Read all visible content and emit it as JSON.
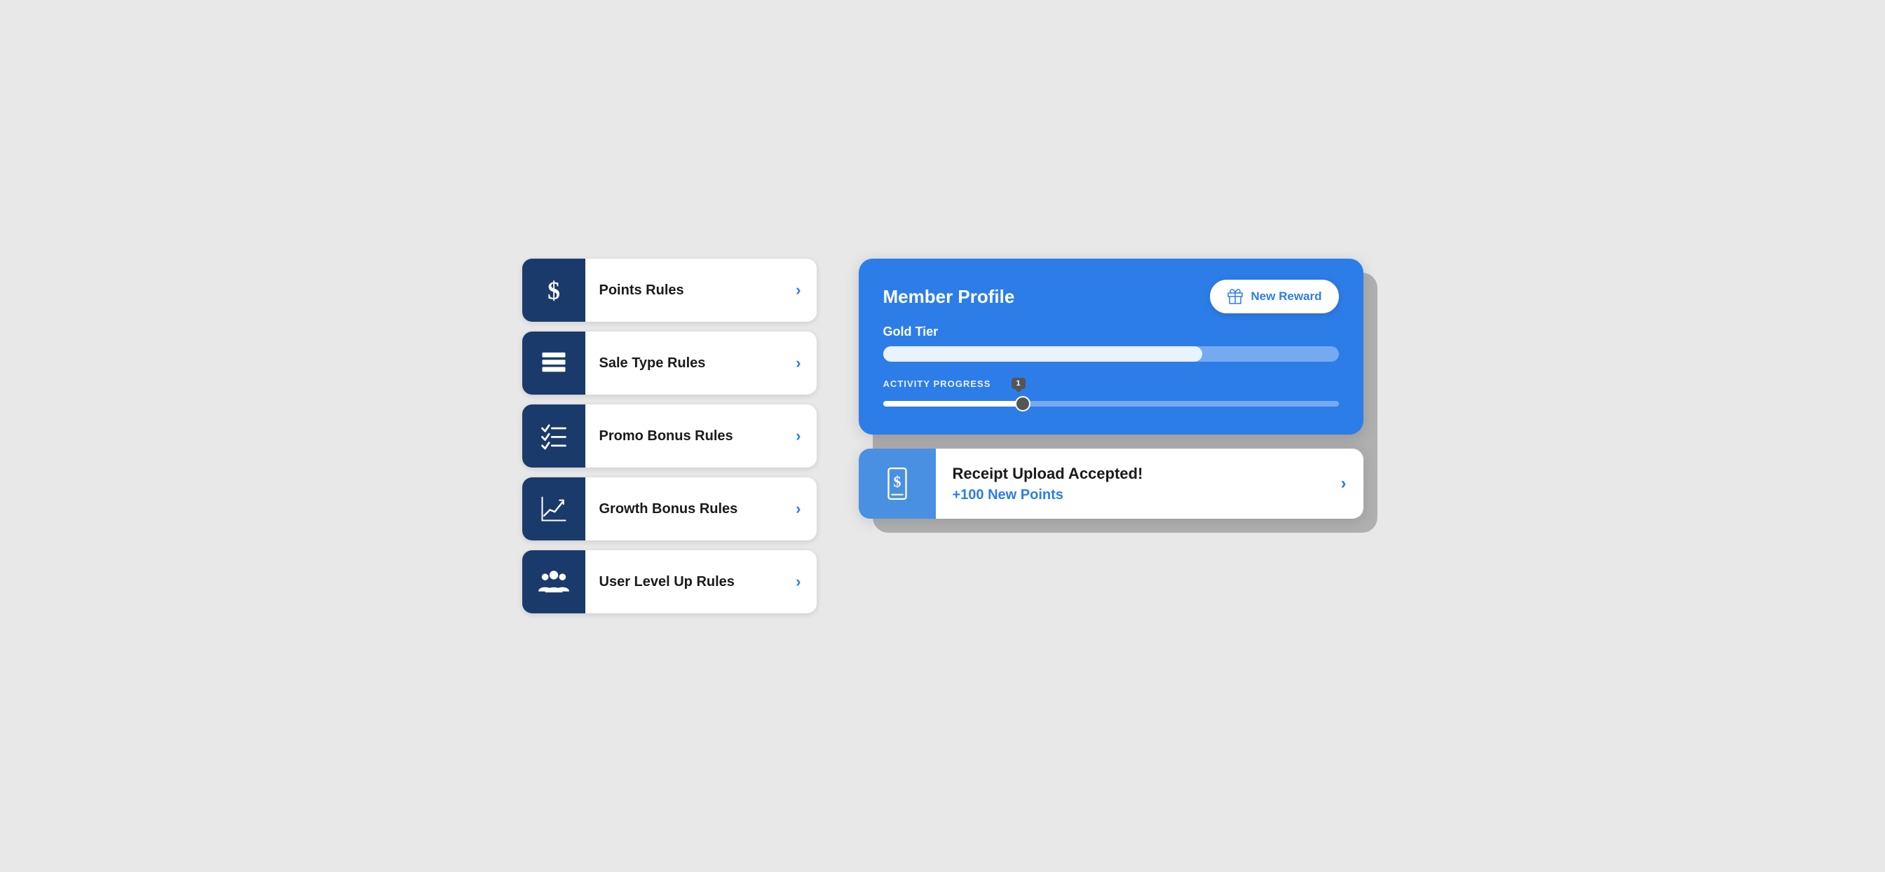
{
  "rules": [
    {
      "id": "points-rules",
      "label": "Points Rules",
      "icon": "dollar"
    },
    {
      "id": "sale-type-rules",
      "label": "Sale Type Rules",
      "icon": "stack"
    },
    {
      "id": "promo-bonus-rules",
      "label": "Promo Bonus Rules",
      "icon": "checklist"
    },
    {
      "id": "growth-bonus-rules",
      "label": "Growth Bonus Rules",
      "icon": "chart"
    },
    {
      "id": "user-level-up-rules",
      "label": "User Level Up Rules",
      "icon": "users"
    }
  ],
  "memberProfile": {
    "title": "Member Profile",
    "tierLabel": "Gold Tier",
    "tierProgress": 70,
    "activityProgressLabel": "Activity Progress",
    "activityValue": 1,
    "activityPercent": 30
  },
  "newReward": {
    "label": "New Reward"
  },
  "receiptCard": {
    "title": "Receipt Upload Accepted!",
    "points": "+100 New Points"
  },
  "chevron": "›",
  "colors": {
    "brand": "#2d7de8",
    "darkBlue": "#1a3a6b",
    "white": "#ffffff"
  }
}
